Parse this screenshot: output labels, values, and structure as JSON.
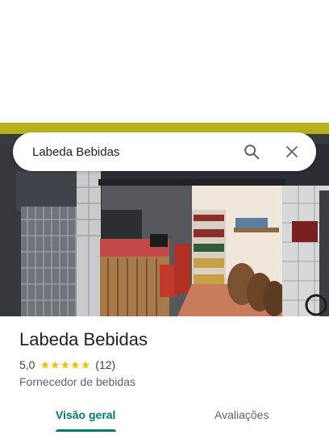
{
  "search": {
    "query": "Labeda Bebidas"
  },
  "place": {
    "name": "Labeda Bebidas",
    "rating": "5,0",
    "stars": 5,
    "review_count": "(12)",
    "category": "Fornecedor de bebidas"
  },
  "tabs": [
    {
      "label": "Visão geral",
      "active": true
    },
    {
      "label": "Avaliações",
      "active": false
    }
  ],
  "icons": [
    "search-icon",
    "close-icon",
    "star-icon"
  ],
  "colors": {
    "accent": "#00796b",
    "star": "#fbbc04",
    "text": "#202124",
    "muted": "#5f6368"
  }
}
